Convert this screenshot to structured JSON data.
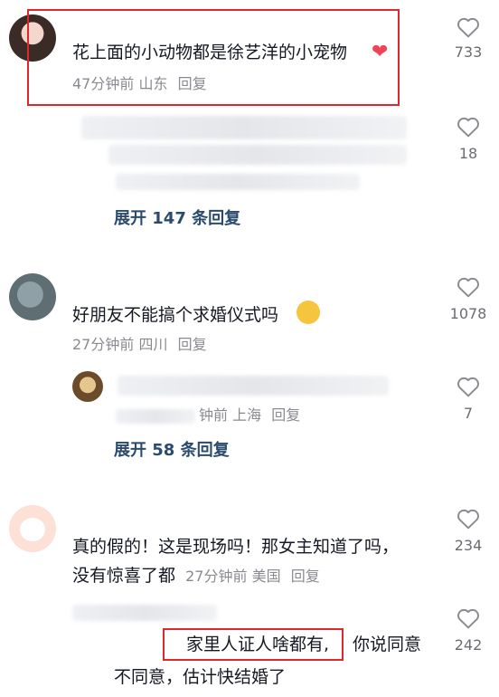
{
  "comments": [
    {
      "text": "花上面的小动物都是徐艺洋的小宠物",
      "time": "47分钟前",
      "location": "山东",
      "reply_label": "回复",
      "likes": "733",
      "expand": "展开 147 条回复"
    },
    {
      "text": "好朋友不能搞个求婚仪式吗",
      "time": "27分钟前",
      "location": "四川",
      "reply_label": "回复",
      "likes": "1078",
      "expand": "展开 58 条回复"
    },
    {
      "text_line1": "真的假的！这是现场吗！那女主知道了吗，",
      "text_line2": "没有惊喜了都",
      "time": "27分钟前",
      "location": "美国",
      "reply_label": "回复",
      "likes": "234"
    }
  ],
  "replies": [
    {
      "likes": "18"
    },
    {
      "time": "钟前",
      "location": "上海",
      "reply_label": "回复",
      "likes": "7"
    },
    {
      "text_highlight": "家里人证人啥都有,",
      "text_rest": "你说同意",
      "text_line2": "不同意，估计快结婚了",
      "likes": "242"
    }
  ],
  "colors": {
    "highlight_box": "#e0262f",
    "heart_outline": "#8a8b91",
    "expand_link": "#2a4b6e"
  }
}
